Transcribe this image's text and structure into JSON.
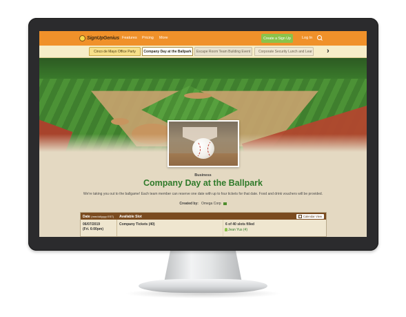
{
  "nav": {
    "logo_text": "SignUpGenius",
    "links": [
      "Features",
      "Pricing",
      "More"
    ],
    "create_button": "Create a Sign Up",
    "login": "Log In"
  },
  "tabs": [
    "Cinco de Mayo Office Party",
    "Company Day at the Ballpark",
    "Escape Room Team Building Event",
    "Corporate Security Lunch and Lear"
  ],
  "event": {
    "category": "Business",
    "title": "Company Day at the Ballpark",
    "description": "We're taking you out to the ballgame! Each team member can reserve one date with up to four tickets for that date. Food and drink vouchers will be provided.",
    "created_by_label": "Created by:",
    "created_by_name": "Omega Corp"
  },
  "table": {
    "col_date": "Date",
    "col_date_format": "(mm/dd/yyyy EST)",
    "col_slot": "Available Slot",
    "calendar_button": "Calendar View",
    "rows": [
      {
        "date": "06/07/2019",
        "time": "(Fri. 6:00pm)",
        "slot": "Company Tickets (40)",
        "filled": "6 of 40 slots filled",
        "person": "Jean Yus (4)"
      }
    ]
  },
  "colors": {
    "nav_orange": "#f0912a",
    "title_green": "#2f7a2a",
    "cta_green": "#8bc34a",
    "table_header_brown": "#7a4b1f"
  }
}
